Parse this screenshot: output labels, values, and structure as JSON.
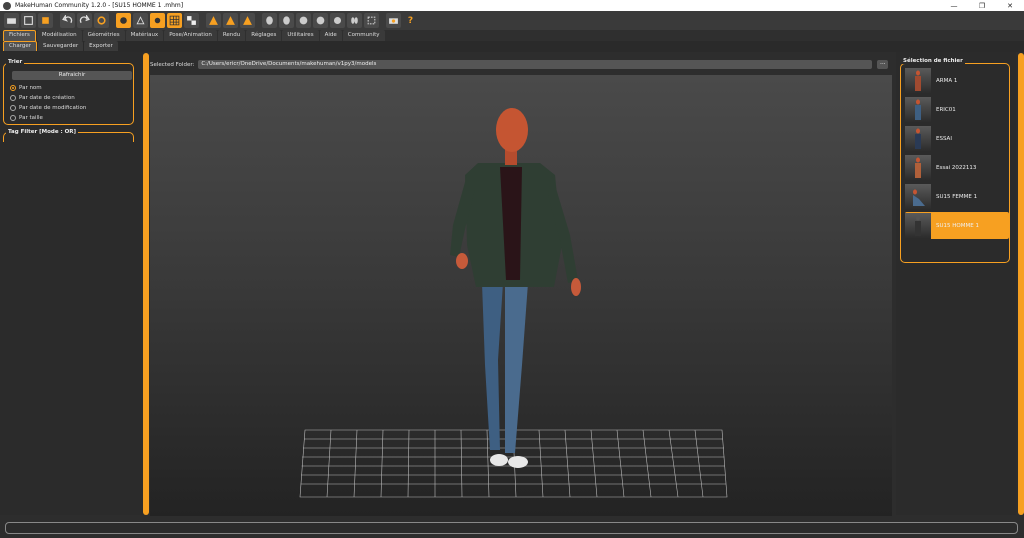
{
  "window": {
    "title": "MakeHuman Community 1.2.0 - [SU15 HOMME 1 .mhm]",
    "controls": [
      "—",
      "❐",
      "✕"
    ]
  },
  "toolbar": {
    "help_label": "?"
  },
  "tabs": [
    {
      "label": "Fichiers",
      "active": true
    },
    {
      "label": "Modélisation"
    },
    {
      "label": "Géométries"
    },
    {
      "label": "Matériaux"
    },
    {
      "label": "Pose/Animation"
    },
    {
      "label": "Rendu"
    },
    {
      "label": "Réglages"
    },
    {
      "label": "Utilitaires"
    },
    {
      "label": "Aide"
    },
    {
      "label": "Community"
    }
  ],
  "subtabs": [
    {
      "label": "Charger",
      "active": true
    },
    {
      "label": "Sauvegarder"
    },
    {
      "label": "Exporter"
    }
  ],
  "left": {
    "sort_title": "Trier",
    "refresh_label": "Rafraichir",
    "sort_options": [
      {
        "label": "Par nom",
        "checked": true
      },
      {
        "label": "Par date de création"
      },
      {
        "label": "Par date de modification"
      },
      {
        "label": "Par taille"
      }
    ],
    "tag_filter_title": "Tag Filter [Mode : OR]"
  },
  "center": {
    "folder_label": "Selected Folder:",
    "folder_path": "C:/Users/ericr/OneDrive/Documents/makehuman/v1py3/models",
    "browse_label": "..."
  },
  "right": {
    "title": "Sélection de fichier",
    "files": [
      {
        "label": "ARMA 1"
      },
      {
        "label": "ERIC01"
      },
      {
        "label": "ESSAI"
      },
      {
        "label": "Essai 2022113"
      },
      {
        "label": "SU15 FEMME 1"
      },
      {
        "label": "SU15 HOMME 1",
        "selected": true
      }
    ]
  },
  "colors": {
    "accent": "#f7a021",
    "background": "#2d2d2d"
  }
}
